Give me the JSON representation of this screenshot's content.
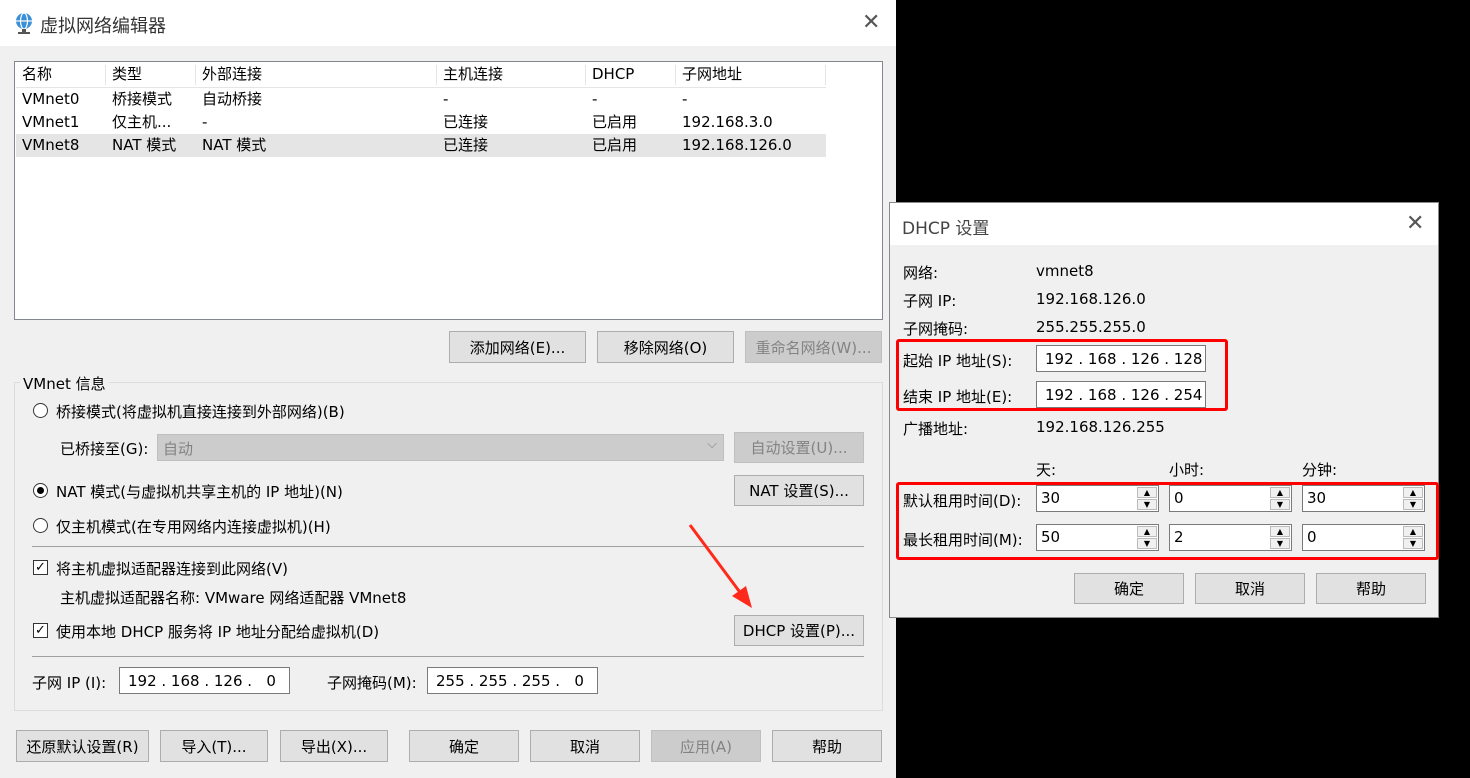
{
  "main": {
    "title": "虚拟网络编辑器",
    "table": {
      "headers": [
        "名称",
        "类型",
        "外部连接",
        "主机连接",
        "DHCP",
        "子网地址"
      ],
      "rows": [
        [
          "VMnet0",
          "桥接模式",
          "自动桥接",
          "-",
          "-",
          "-"
        ],
        [
          "VMnet1",
          "仅主机...",
          "-",
          "已连接",
          "已启用",
          "192.168.3.0"
        ],
        [
          "VMnet8",
          "NAT 模式",
          "NAT 模式",
          "已连接",
          "已启用",
          "192.168.126.0"
        ]
      ]
    },
    "add_network": "添加网络(E)...",
    "remove_network": "移除网络(O)",
    "rename_network": "重命名网络(W)...",
    "vmnet_info": "VMnet 信息",
    "bridge_mode": "桥接模式(将虚拟机直接连接到外部网络)(B)",
    "bridged_to_label": "已桥接至(G):",
    "bridged_to_value": "自动",
    "auto_settings": "自动设置(U)...",
    "nat_mode": "NAT 模式(与虚拟机共享主机的 IP 地址)(N)",
    "nat_settings": "NAT 设置(S)...",
    "host_only_mode": "仅主机模式(在专用网络内连接虚拟机)(H)",
    "connect_adapter": "将主机虚拟适配器连接到此网络(V)",
    "adapter_name": "主机虚拟适配器名称: VMware 网络适配器 VMnet8",
    "use_dhcp": "使用本地 DHCP 服务将 IP 地址分配给虚拟机(D)",
    "dhcp_settings": "DHCP 设置(P)...",
    "subnet_ip_label": "子网 IP (I):",
    "subnet_ip": "192 . 168 . 126 .   0",
    "subnet_mask_label": "子网掩码(M):",
    "subnet_mask": "255 . 255 . 255 .   0",
    "restore_defaults": "还原默认设置(R)",
    "import": "导入(T)...",
    "export": "导出(X)...",
    "ok": "确定",
    "cancel": "取消",
    "apply": "应用(A)",
    "help": "帮助"
  },
  "dhcp": {
    "title": "DHCP 设置",
    "network_label": "网络:",
    "network_value": "vmnet8",
    "subnet_ip_label": "子网 IP:",
    "subnet_ip_value": "192.168.126.0",
    "mask_label": "子网掩码:",
    "mask_value": "255.255.255.0",
    "start_ip_label": "起始 IP 地址(S):",
    "start_ip": "192 . 168 . 126 . 128",
    "end_ip_label": "结束 IP 地址(E):",
    "end_ip": "192 . 168 . 126 . 254",
    "broadcast_label": "广播地址:",
    "broadcast_value": "192.168.126.255",
    "days": "天:",
    "hours": "小时:",
    "minutes": "分钟:",
    "default_lease_label": "默认租用时间(D):",
    "default_lease": [
      "30",
      "0",
      "30"
    ],
    "max_lease_label": "最长租用时间(M):",
    "max_lease": [
      "50",
      "2",
      "0"
    ],
    "ok": "确定",
    "cancel": "取消",
    "help": "帮助"
  },
  "colors": {
    "highlight": "#ff0000",
    "selected_row": "#e5e5e5"
  }
}
